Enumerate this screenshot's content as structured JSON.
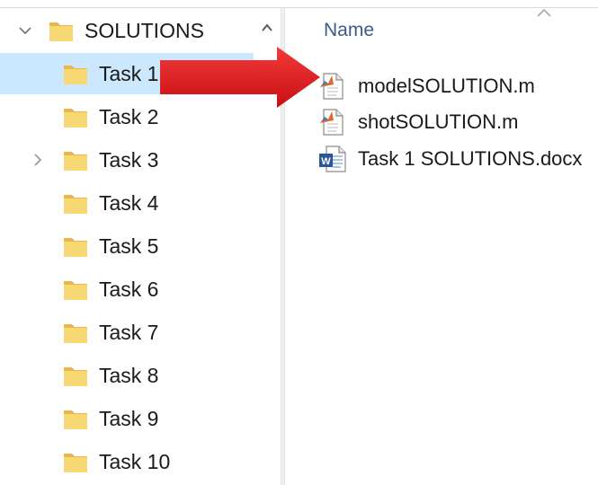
{
  "nav": {
    "root": {
      "label": "SOLUTIONS",
      "expanded": true
    },
    "items": [
      {
        "label": "Task 1",
        "selected": true
      },
      {
        "label": "Task 2"
      },
      {
        "label": "Task 3",
        "has_children": true
      },
      {
        "label": "Task 4"
      },
      {
        "label": "Task 5"
      },
      {
        "label": "Task 6"
      },
      {
        "label": "Task 7"
      },
      {
        "label": "Task 8"
      },
      {
        "label": "Task 9"
      },
      {
        "label": "Task 10"
      }
    ]
  },
  "content": {
    "column_header": "Name",
    "files": [
      {
        "name": "modelSOLUTION.m",
        "icon": "matlab-file-icon"
      },
      {
        "name": "shotSOLUTION.m",
        "icon": "matlab-file-icon"
      },
      {
        "name": "Task 1 SOLUTIONS.docx",
        "icon": "word-document-icon"
      }
    ]
  },
  "colors": {
    "selection": "#cce8ff",
    "folder": "#f8d775",
    "arrow": "#e8141b",
    "header_text": "#3c5a8a"
  }
}
